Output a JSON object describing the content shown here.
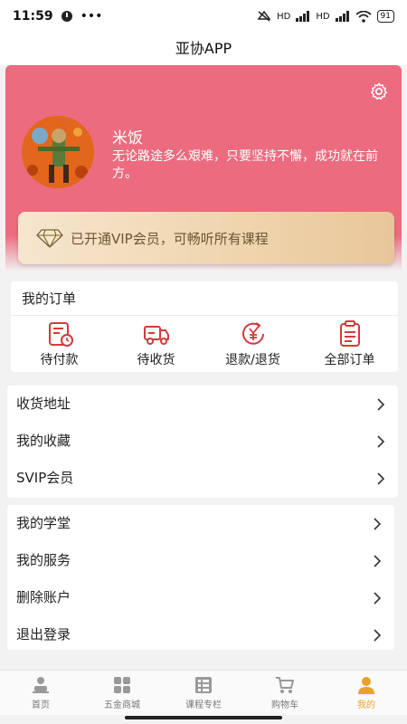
{
  "status_bar": {
    "time": "11:59",
    "battery": "91",
    "network_label_1": "HD",
    "network_label_2": "HD"
  },
  "header": {
    "title": "亚协APP"
  },
  "profile": {
    "username": "米饭",
    "motto": "无论路途多么艰难，只要坚持不懈，成功就在前方。"
  },
  "vip": {
    "text": "已开通VIP会员，可畅听所有课程"
  },
  "orders": {
    "title": "我的订单",
    "items": [
      {
        "label": "待付款",
        "icon": "pending-payment-icon"
      },
      {
        "label": "待收货",
        "icon": "truck-icon"
      },
      {
        "label": "退款/退货",
        "icon": "refund-icon"
      },
      {
        "label": "全部订单",
        "icon": "clipboard-icon"
      }
    ]
  },
  "menu_group_1": {
    "items": [
      {
        "label": "收货地址"
      },
      {
        "label": "我的收藏"
      },
      {
        "label": "SVIP会员"
      }
    ]
  },
  "menu_group_2": {
    "items": [
      {
        "label": "我的学堂"
      },
      {
        "label": "我的服务"
      },
      {
        "label": "删除账户"
      },
      {
        "label": "退出登录"
      }
    ]
  },
  "tab_bar": {
    "tabs": [
      {
        "label": "首页",
        "icon": "home-person-icon"
      },
      {
        "label": "五金商城",
        "icon": "grid-icon"
      },
      {
        "label": "课程专栏",
        "icon": "list-icon"
      },
      {
        "label": "购物车",
        "icon": "cart-icon"
      },
      {
        "label": "我的",
        "icon": "profile-icon"
      }
    ],
    "active_index": 4
  },
  "colors": {
    "hero": "#ec6b7f",
    "accent_red": "#d23b3b",
    "tab_active": "#e8a22a",
    "vip_gold": "#efd4ad"
  }
}
